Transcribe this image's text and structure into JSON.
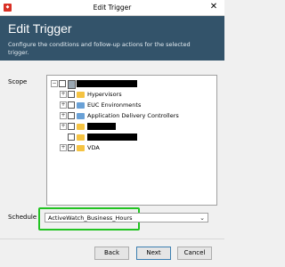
{
  "window": {
    "title": "Edit Trigger",
    "app_icon": "app-logo-icon",
    "close_glyph": "✕"
  },
  "header": {
    "title": "Edit Trigger",
    "description": "Configure the conditions and follow-up actions for the selected trigger."
  },
  "scope": {
    "label": "Scope",
    "tree": [
      {
        "label": "Hypervisors",
        "checked": false,
        "icon": "folder-icon"
      },
      {
        "label": "EUC Environments",
        "checked": false,
        "icon": "folder-icon"
      },
      {
        "label": "Application Delivery Controllers",
        "checked": false,
        "icon": "folder-icon"
      },
      {
        "label": "VDA",
        "checked": true,
        "icon": "folder-icon"
      }
    ]
  },
  "schedule": {
    "label": "Schedule",
    "value": "ActiveWatch_Business_Hours",
    "highlight_color": "#22c322"
  },
  "buttons": {
    "back": "Back",
    "next": "Next",
    "cancel": "Cancel"
  },
  "colors": {
    "header_bg": "#33536a"
  }
}
